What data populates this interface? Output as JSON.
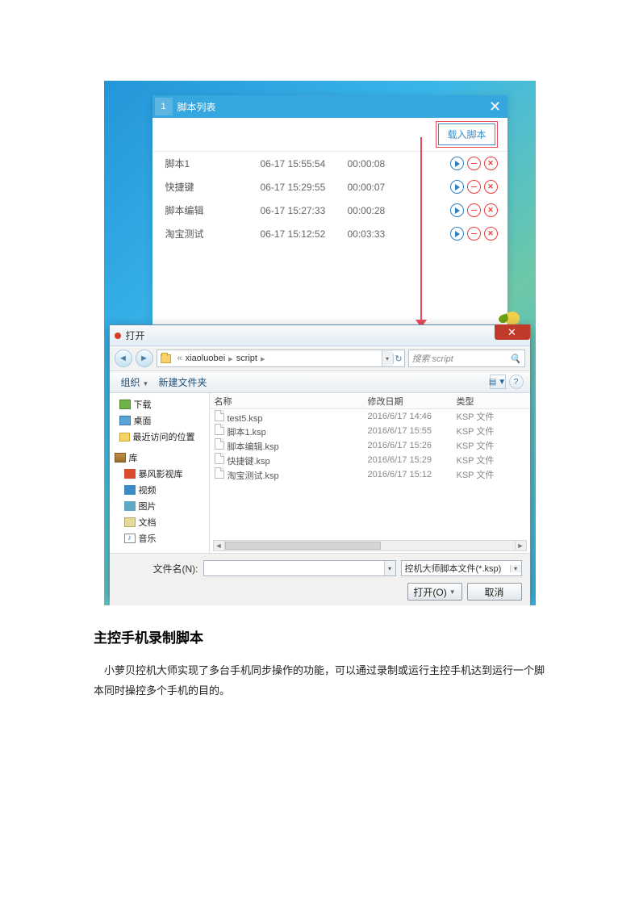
{
  "scriptPanel": {
    "index": "1",
    "title": "脚本列表",
    "loadBtn": "载入脚本",
    "rows": [
      {
        "name": "脚本1",
        "time": "06-17 15:55:54",
        "dur": "00:00:08"
      },
      {
        "name": "快捷键",
        "time": "06-17 15:29:55",
        "dur": "00:00:07"
      },
      {
        "name": "脚本编辑",
        "time": "06-17 15:27:33",
        "dur": "00:00:28"
      },
      {
        "name": "淘宝测试",
        "time": "06-17 15:12:52",
        "dur": "00:03:33"
      }
    ]
  },
  "openDialog": {
    "title": "打开",
    "path": {
      "seg1": "xiaoluobei",
      "seg2": "script"
    },
    "searchPlaceholder": "搜索 script",
    "toolbar": {
      "organize": "组织",
      "newFolder": "新建文件夹"
    },
    "tree": {
      "downloads": "下载",
      "desktop": "桌面",
      "recent": "最近访问的位置",
      "libraries": "库",
      "baofeng": "暴风影视库",
      "video": "视频",
      "pictures": "图片",
      "documents": "文档",
      "music": "音乐"
    },
    "headers": {
      "name": "名称",
      "date": "修改日期",
      "type": "类型"
    },
    "files": [
      {
        "name": "test5.ksp",
        "date": "2016/6/17 14:46",
        "type": "KSP 文件"
      },
      {
        "name": "脚本1.ksp",
        "date": "2016/6/17 15:55",
        "type": "KSP 文件"
      },
      {
        "name": "脚本编辑.ksp",
        "date": "2016/6/17 15:26",
        "type": "KSP 文件"
      },
      {
        "name": "快捷键.ksp",
        "date": "2016/6/17 15:29",
        "type": "KSP 文件"
      },
      {
        "name": "淘宝测试.ksp",
        "date": "2016/6/17 15:12",
        "type": "KSP 文件"
      }
    ],
    "fileNameLabel": "文件名(N):",
    "filter": "控机大师脚本文件(*.ksp)",
    "openBtn": "打开(O)",
    "cancelBtn": "取消"
  },
  "article": {
    "heading": "主控手机录制脚本",
    "body": "小萝贝控机大师实现了多台手机同步操作的功能，可以通过录制或运行主控手机达到运行一个脚本同时操控多个手机的目的。"
  }
}
